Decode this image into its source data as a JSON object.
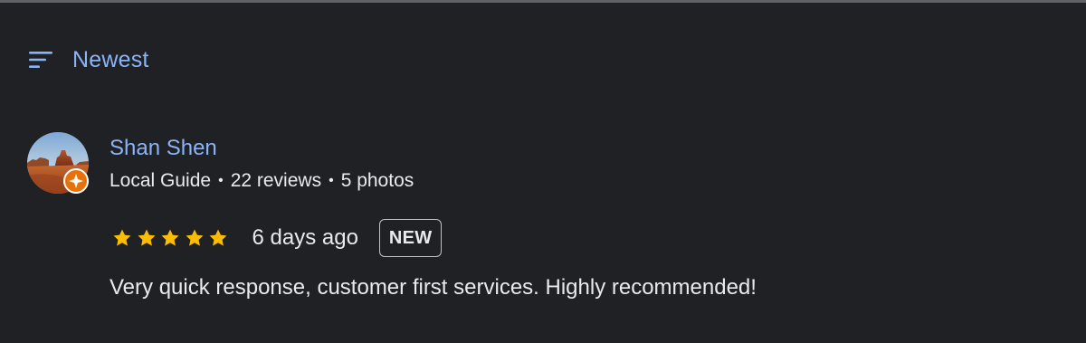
{
  "sort": {
    "icon": "sort-icon",
    "label": "Newest",
    "accent_color": "#8ab4f8"
  },
  "review": {
    "reviewer": {
      "name": "Shan Shen",
      "badge": "Local Guide",
      "reviews": "22 reviews",
      "photos": "5 photos",
      "separator": "•",
      "avatar_icon": "avatar",
      "badge_icon": "local-guide-badge-icon"
    },
    "rating": 5,
    "rating_max": 5,
    "star_color": "#fbbc04",
    "date": "6 days ago",
    "new_badge": "NEW",
    "text": "Very quick response, customer first services. Highly recommended!"
  }
}
